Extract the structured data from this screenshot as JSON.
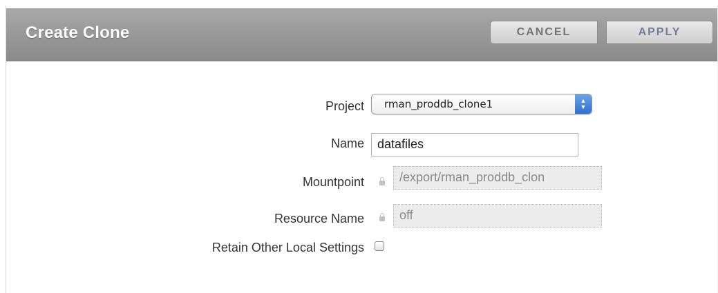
{
  "dialog": {
    "title": "Create Clone",
    "buttons": {
      "cancel_label": "CANCEL",
      "apply_label": "APPLY"
    }
  },
  "form": {
    "project": {
      "label": "Project",
      "selected_value": "rman_proddb_clone1"
    },
    "name": {
      "label": "Name",
      "value": "datafiles"
    },
    "mountpoint": {
      "label": "Mountpoint",
      "value": "/export/rman_proddb_clon",
      "locked": true
    },
    "resource_name": {
      "label": "Resource Name",
      "value": "off",
      "locked": true
    },
    "retain_settings": {
      "label": "Retain Other Local Settings",
      "checked": false
    }
  },
  "icons": {
    "select_arrows": "updown-arrows-icon",
    "lock": "lock-icon"
  }
}
